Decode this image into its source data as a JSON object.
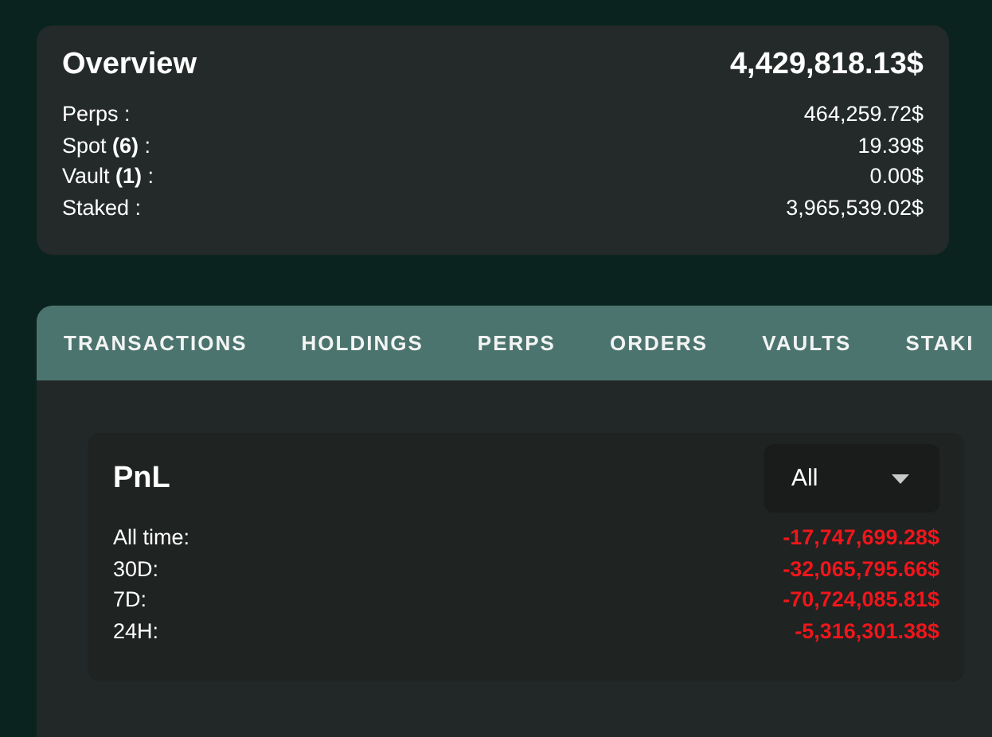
{
  "overview": {
    "title": "Overview",
    "total": "4,429,818.13$",
    "rows": [
      {
        "label": "Perps :",
        "value": "464,259.72$"
      },
      {
        "label": "Spot **(6)** :",
        "value": "19.39$"
      },
      {
        "label": "Vault **(1)** :",
        "value": "0.00$"
      },
      {
        "label": "Staked :",
        "value": "3,965,539.02$"
      }
    ]
  },
  "tabs": [
    {
      "label": "TRANSACTIONS",
      "selected": false
    },
    {
      "label": "HOLDINGS",
      "selected": false
    },
    {
      "label": "PERPS",
      "selected": false
    },
    {
      "label": "ORDERS",
      "selected": false
    },
    {
      "label": "VAULTS",
      "selected": false
    },
    {
      "label": "STAKI",
      "selected": false
    }
  ],
  "pnl": {
    "title": "PnL",
    "dropdown": {
      "value": "All"
    },
    "rows": [
      {
        "label": "All time:",
        "value": "-17,747,699.28$"
      },
      {
        "label": "30D:",
        "value": "-32,065,795.66$"
      },
      {
        "label": "7D:",
        "value": "-70,724,085.81$"
      },
      {
        "label": "24H:",
        "value": "-5,316,301.38$"
      }
    ]
  }
}
